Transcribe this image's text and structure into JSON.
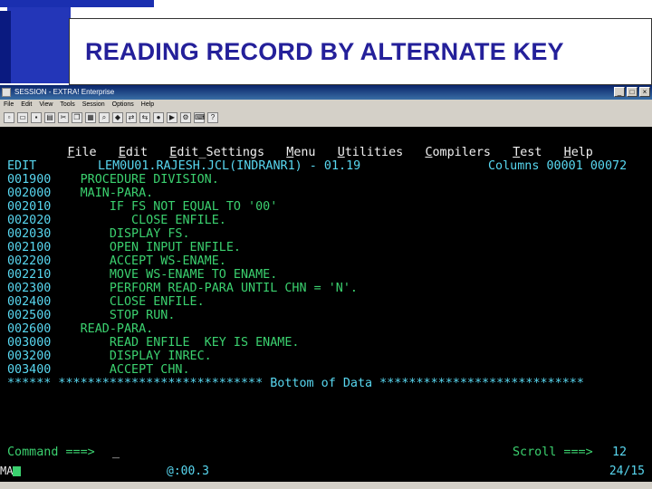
{
  "slide": {
    "title": "READING RECORD BY ALTERNATE KEY"
  },
  "window": {
    "title": "SESSION - EXTRA! Enterprise",
    "buttons": [
      "_",
      "□",
      "×"
    ],
    "menu": [
      "File",
      "Edit",
      "View",
      "Tools",
      "Session",
      "Options",
      "Help"
    ]
  },
  "ispf": {
    "menubar": [
      "File",
      "Edit",
      "Edit_Settings",
      "Menu",
      "Utilities",
      "Compilers",
      "Test",
      "Help"
    ],
    "mode": "EDIT",
    "dataset": "LEM0U01.RAJESH.JCL(INDRANR1) - 01.19",
    "columns": "Columns 00001 00072",
    "lines": [
      {
        "num": "001900",
        "text": "    PROCEDURE DIVISION."
      },
      {
        "num": "002000",
        "text": "    MAIN-PARA."
      },
      {
        "num": "002010",
        "text": "        IF FS NOT EQUAL TO '00'"
      },
      {
        "num": "002020",
        "text": "           CLOSE ENFILE."
      },
      {
        "num": "002030",
        "text": "        DISPLAY FS."
      },
      {
        "num": "002100",
        "text": "        OPEN INPUT ENFILE."
      },
      {
        "num": "002200",
        "text": "        ACCEPT WS-ENAME."
      },
      {
        "num": "002210",
        "text": "        MOVE WS-ENAME TO ENAME."
      },
      {
        "num": "002300",
        "text": "        PERFORM READ-PARA UNTIL CHN = 'N'."
      },
      {
        "num": "002400",
        "text": "        CLOSE ENFILE."
      },
      {
        "num": "002500",
        "text": "        STOP RUN."
      },
      {
        "num": "002600",
        "text": "    READ-PARA."
      },
      {
        "num": "003000",
        "text": "        READ ENFILE  KEY IS ENAME."
      },
      {
        "num": "003200",
        "text": "        DISPLAY INREC."
      },
      {
        "num": "003400",
        "text": "        ACCEPT CHN."
      }
    ],
    "bottom_line": "****** **************************** Bottom of Data ****************************",
    "command_label": "Command ===>",
    "command_value": "_",
    "scroll_label": "Scroll ===>",
    "scroll_value": "12"
  },
  "status": {
    "left": "MA",
    "timer": "@:00.3",
    "cursor_pos": "24/15"
  },
  "colors": {
    "terminal_bg": "#000000",
    "green": "#3bd16f",
    "blue": "#6aa0ff",
    "cyan": "#58d7f0",
    "title": "#24209a"
  }
}
